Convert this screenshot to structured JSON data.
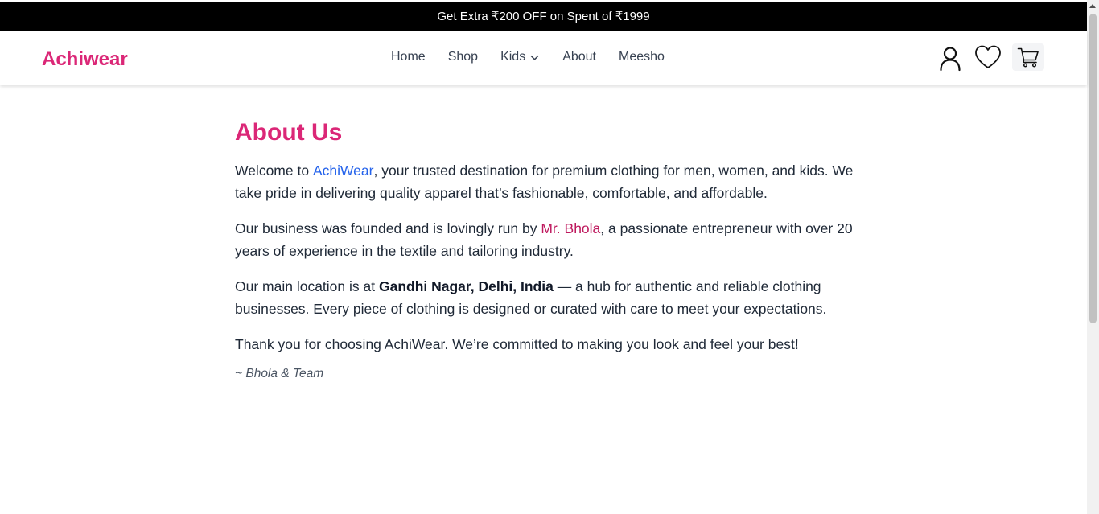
{
  "promo": {
    "text": "Get Extra ₹200 OFF on Spent of ₹1999"
  },
  "header": {
    "logo": "Achiwear",
    "nav": [
      {
        "label": "Home"
      },
      {
        "label": "Shop"
      },
      {
        "label": "Kids",
        "has_dropdown": true
      },
      {
        "label": "About"
      },
      {
        "label": "Meesho"
      }
    ],
    "icons": [
      "user-icon",
      "heart-icon",
      "cart-icon"
    ]
  },
  "about": {
    "title": "About Us",
    "p1_before": "Welcome to ",
    "p1_brand": "AchiWear",
    "p1_after": ", your trusted destination for premium clothing for men, women, and kids. We take pride in delivering quality apparel that’s fashionable, comfortable, and affordable.",
    "p2_before": "Our business was founded and is lovingly run by ",
    "p2_owner": "Mr. Bhola",
    "p2_after": ", a passionate entrepreneur with over 20 years of experience in the textile and tailoring industry.",
    "p3_before": "Our main location is at ",
    "p3_location": "Gandhi Nagar, Delhi, India",
    "p3_after": " — a hub for authentic and reliable clothing businesses. Every piece of clothing is designed or curated with care to meet your expectations.",
    "p4": "Thank you for choosing AchiWear. We’re committed to making you look and feel your best!",
    "signature": "~ Bhola & Team"
  },
  "colors": {
    "brand_pink": "#db2777",
    "link_blue": "#2563eb",
    "owner_pink": "#be185d",
    "promo_bg": "#000000"
  }
}
